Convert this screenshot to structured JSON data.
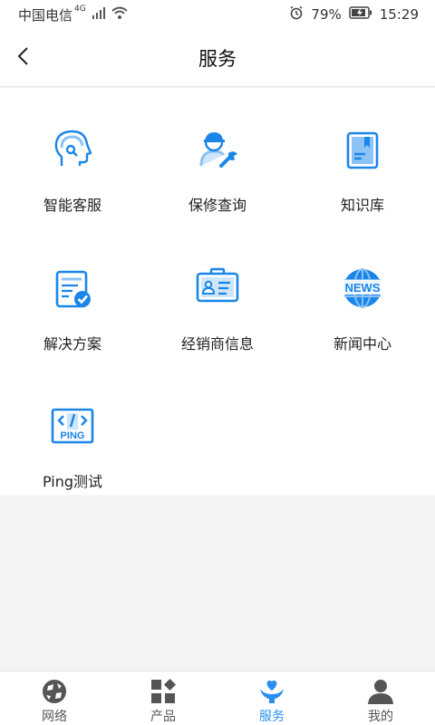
{
  "status_bar": {
    "carrier": "中国电信",
    "network": "4G",
    "battery": "79%",
    "time": "15:29",
    "icons": [
      "signal-icon",
      "wifi-icon",
      "alarm-icon",
      "battery-icon"
    ]
  },
  "header": {
    "title": "服务",
    "back_icon": "back-chevron-icon"
  },
  "services": [
    {
      "label": "智能客服",
      "icon": "smart-support-icon"
    },
    {
      "label": "保修查询",
      "icon": "warranty-query-icon"
    },
    {
      "label": "知识库",
      "icon": "knowledge-base-icon"
    },
    {
      "label": "解决方案",
      "icon": "solution-icon"
    },
    {
      "label": "经销商信息",
      "icon": "dealer-info-icon"
    },
    {
      "label": "新闻中心",
      "icon": "news-center-icon"
    },
    {
      "label": "Ping测试",
      "icon": "ping-test-icon"
    }
  ],
  "icon_text": {
    "news": "NEWS",
    "ping": "PING"
  },
  "tabs": [
    {
      "label": "网络",
      "icon": "network-icon",
      "active": false
    },
    {
      "label": "产品",
      "icon": "products-icon",
      "active": false
    },
    {
      "label": "服务",
      "icon": "service-icon",
      "active": true
    },
    {
      "label": "我的",
      "icon": "profile-icon",
      "active": false
    }
  ],
  "colors": {
    "accent": "#2b8ef0",
    "icon_blue": "#1a86e8",
    "icon_light": "#8cc3f7",
    "tab_gray": "#555555"
  }
}
